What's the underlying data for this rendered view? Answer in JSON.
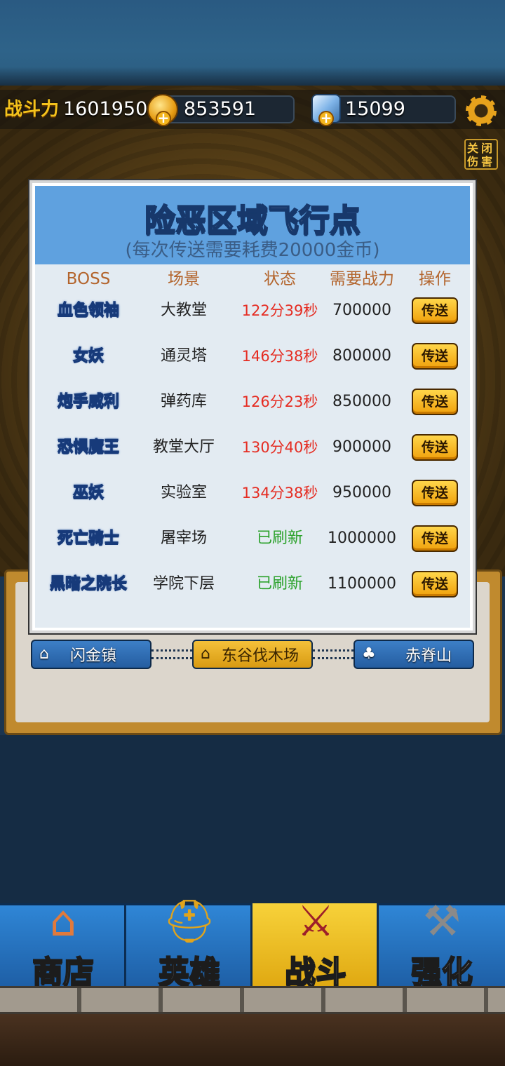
{
  "stats": {
    "power_label": "战斗力",
    "power_value": "1601950",
    "gold": "853591",
    "gems": "15099",
    "damage_toggle": "关闭伤害"
  },
  "modal": {
    "title": "险恶区域飞行点",
    "subtitle": "(每次传送需要耗费20000金币)",
    "columns": [
      "BOSS",
      "场景",
      "状态",
      "需要战力",
      "操作"
    ],
    "rows": [
      {
        "boss": "血色领袖",
        "scene": "大教堂",
        "status": "122分39秒",
        "required": "700000",
        "action": "传送"
      },
      {
        "boss": "女妖",
        "scene": "通灵塔",
        "status": "146分38秒",
        "required": "800000",
        "action": "传送"
      },
      {
        "boss": "炮手威利",
        "scene": "弹药库",
        "status": "126分23秒",
        "required": "850000",
        "action": "传送"
      },
      {
        "boss": "恐惧魔王",
        "scene": "教堂大厅",
        "status": "130分40秒",
        "required": "900000",
        "action": "传送"
      },
      {
        "boss": "巫妖",
        "scene": "实验室",
        "status": "134分38秒",
        "required": "950000",
        "action": "传送"
      },
      {
        "boss": "死亡骑士",
        "scene": "屠宰场",
        "status": "已刷新",
        "required": "1000000",
        "action": "传送"
      },
      {
        "boss": "黑暗之院长",
        "scene": "学院下层",
        "status": "已刷新",
        "required": "1100000",
        "action": "传送"
      }
    ]
  },
  "map": {
    "nodes": [
      {
        "label": "闪金镇",
        "icon": "house-icon"
      },
      {
        "label": "东谷伐木场",
        "icon": "house-icon"
      },
      {
        "label": "赤脊山",
        "icon": "tree-icon"
      }
    ]
  },
  "nav": {
    "tabs": [
      {
        "label": "商店",
        "icon": "shop-icon"
      },
      {
        "label": "英雄",
        "icon": "helmet-icon"
      },
      {
        "label": "战斗",
        "icon": "crossed-swords-icon",
        "active": true
      },
      {
        "label": "强化",
        "icon": "hammer-icon"
      }
    ]
  },
  "colors": {
    "modal_header": "#5fa1df",
    "countdown_red": "#e52c22",
    "refreshed_green": "#2aa12a",
    "active_tab": "#f7d23a",
    "button_gold": "#f0a10c"
  }
}
